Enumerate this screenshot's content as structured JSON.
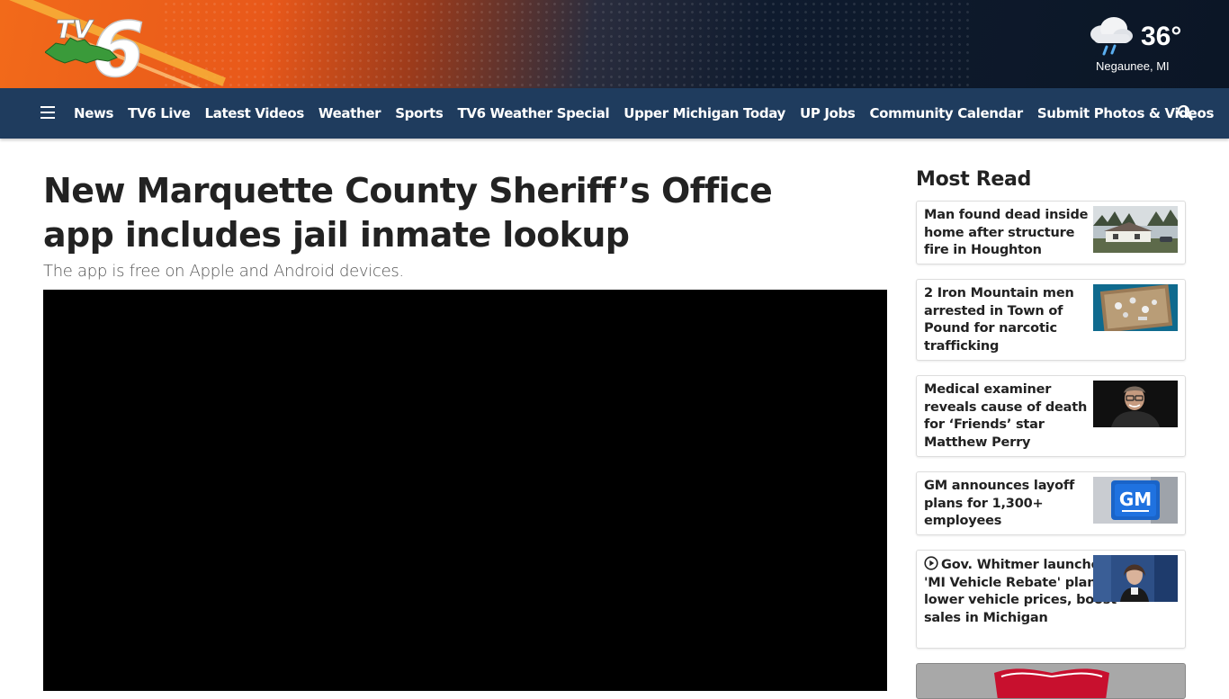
{
  "brand": {
    "logo_text": "TV6"
  },
  "weather": {
    "icon": "rain-cloud-icon",
    "temperature": "36°",
    "location": "Negaunee, MI"
  },
  "nav": {
    "items": [
      "News",
      "TV6 Live",
      "Latest Videos",
      "Weather",
      "Sports",
      "TV6 Weather Special",
      "Upper Michigan Today",
      "UP Jobs",
      "Community Calendar",
      "Submit Photos & Videos"
    ]
  },
  "article": {
    "headline": "New Marquette County Sheriff’s Office app includes jail inmate lookup",
    "subheadline": "The app is free on Apple and Android devices."
  },
  "sidebar": {
    "title": "Most Read",
    "items": [
      {
        "title": "Man found dead inside home after structure fire in Houghton",
        "video": false
      },
      {
        "title": "2 Iron Mountain men arrested in Town of Pound for narcotic trafficking",
        "video": false
      },
      {
        "title": "Medical examiner reveals cause of death for ‘Friends’ star Matthew Perry",
        "video": false
      },
      {
        "title": "GM announces layoff plans for 1,300+ employees",
        "video": false
      },
      {
        "title": "Gov. Whitmer launches 'MI Vehicle Rebate' plan to lower vehicle prices, boost sales in Michigan",
        "video": true
      }
    ]
  },
  "colors": {
    "nav_bg": "#1f3c5e",
    "header_orange": "#f26a1a",
    "header_navy": "#0b1626",
    "text": "#222222"
  }
}
